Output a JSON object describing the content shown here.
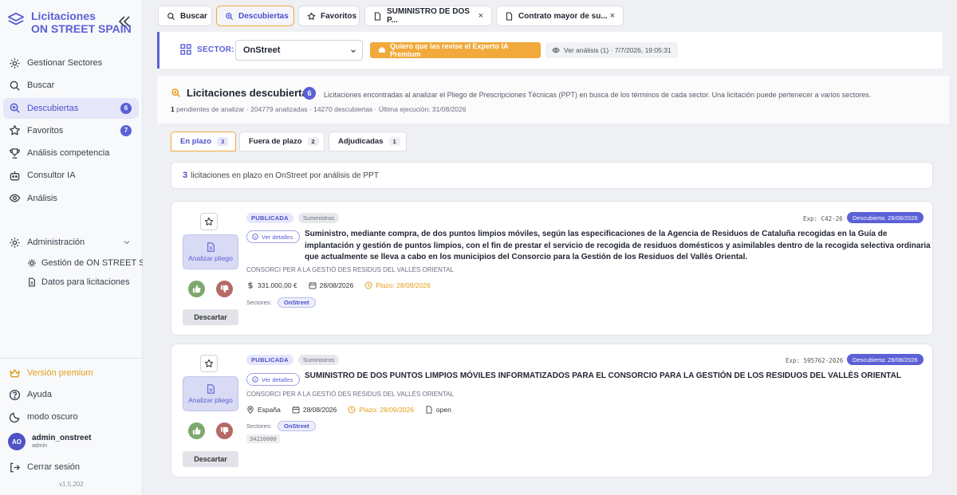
{
  "sidebar": {
    "brand_line1": "Licitaciones",
    "brand_line2": "ON STREET SPAIN",
    "items": [
      {
        "label": "Gestionar Sectores",
        "icon": "building-icon"
      },
      {
        "label": "Buscar",
        "icon": "search-icon"
      },
      {
        "label": "Descubiertas",
        "icon": "discover-icon",
        "badge": "6",
        "active": true
      },
      {
        "label": "Favoritos",
        "icon": "star-icon",
        "badge": "7"
      },
      {
        "label": "Análisis competencia",
        "icon": "trophy-icon"
      },
      {
        "label": "Consultor IA",
        "icon": "robot-icon"
      },
      {
        "label": "Análisis",
        "icon": "eye-icon"
      }
    ],
    "admin": {
      "label": "Administración",
      "subitems": [
        {
          "label": "Gestión de ON STREET SPAIN"
        },
        {
          "label": "Datos para licitaciones"
        }
      ]
    },
    "premium": "Versión premium",
    "help": "Ayuda",
    "dark_mode": "modo oscuro",
    "user": {
      "initials": "AO",
      "name": "admin_onstreet",
      "role": "admin"
    },
    "logout": "Cerrar sesión",
    "version": "v1.5.202"
  },
  "tabs": [
    {
      "label": "Buscar"
    },
    {
      "label": "Descubiertas",
      "active": true
    },
    {
      "label": "Favoritos"
    },
    {
      "label": "SUMINISTRO DE DOS P..."
    },
    {
      "label": "Contrato mayor de su..."
    }
  ],
  "sector_bar": {
    "label": "SECTOR:",
    "selected": "OnStreet",
    "expert_button": "Quiero que las revise el Experto IA Premium",
    "analysis_button": "Ver análisis (1) · 7/7/2026, 19:05:31"
  },
  "header": {
    "title": "Licitaciones descubiertas",
    "badge": "6",
    "description": "Licitaciones encontradas al analizar el Pliego de Prescripciones Técnicas (PPT) en busca de los términos de cada sector. Una licitación puede pertenecer a varios sectores.",
    "stats_bold": "1",
    "stats_rest": " pendientes de analizar · 204779 analizadas · 14270 descubiertas · Última ejecución: 31/08/2026"
  },
  "status_tabs": [
    {
      "label": "En plazo",
      "count": "3",
      "active": true
    },
    {
      "label": "Fuera de plazo",
      "count": "2"
    },
    {
      "label": "Adjudicadas",
      "count": "1"
    }
  ],
  "summary": {
    "count": "3",
    "text": "licitaciones en plazo en OnStreet por análisis de PPT"
  },
  "cards": [
    {
      "status": "PUBLICADA",
      "category": "Suministros",
      "exp": "Exp: C42-26",
      "discovered": "Descubierta: 28/08/2026",
      "details": "Ver detalles",
      "title": "Suministro, mediante compra, de dos puntos limpios móviles, según las especificaciones de la Agencia de Residuos de Cataluña recogidas en la Guía de implantación y gestión de puntos limpios, con el fin de prestar el servicio de recogida de residuos domésticos y asimilables dentro de la recogida selectiva ordinaria que actualmente se lleva a cabo en los municipios del Consorcio para la Gestión de los Residuos del Vallès Oriental.",
      "org": "CONSORCI PER A LA GESTIÓ DES RESIDUS DEL VALLÈS ORIENTAL",
      "amount": "331.000,00 €",
      "date": "28/08/2026",
      "deadline": "Plazo: 28/09/2026",
      "sectors_label": "Sectores:",
      "sector": "OnStreet",
      "analyze": "Analizar pliego",
      "discard": "Descartar"
    },
    {
      "status": "PUBLICADA",
      "category": "Suministros",
      "exp": "Exp: 595762-2026",
      "discovered": "Descubierta: 28/08/2026",
      "details": "Ver detalles",
      "title": "SUMINISTRO DE DOS PUNTOS LIMPIOS MÓVILES INFORMATIZADOS PARA EL CONSORCIO PARA LA GESTIÓN DE LOS RESIDUOS DEL VALLÈS ORIENTAL",
      "org": "CONSORCI PER A LA GESTIÓ DES RESIDUS DEL VALLÈS ORIENTAL",
      "location": "España",
      "date": "28/08/2026",
      "deadline": "Plazo: 28/09/2026",
      "procedure": "open",
      "sectors_label": "Sectores:",
      "sector": "OnStreet",
      "cpv": "34220000",
      "analyze": "Analizar pliego",
      "discard": "Descartar"
    }
  ],
  "colors": {
    "accent": "#5b60d6",
    "premium": "#f0a93a",
    "thumb_up": "#7ea86d",
    "thumb_down": "#b56a66"
  }
}
